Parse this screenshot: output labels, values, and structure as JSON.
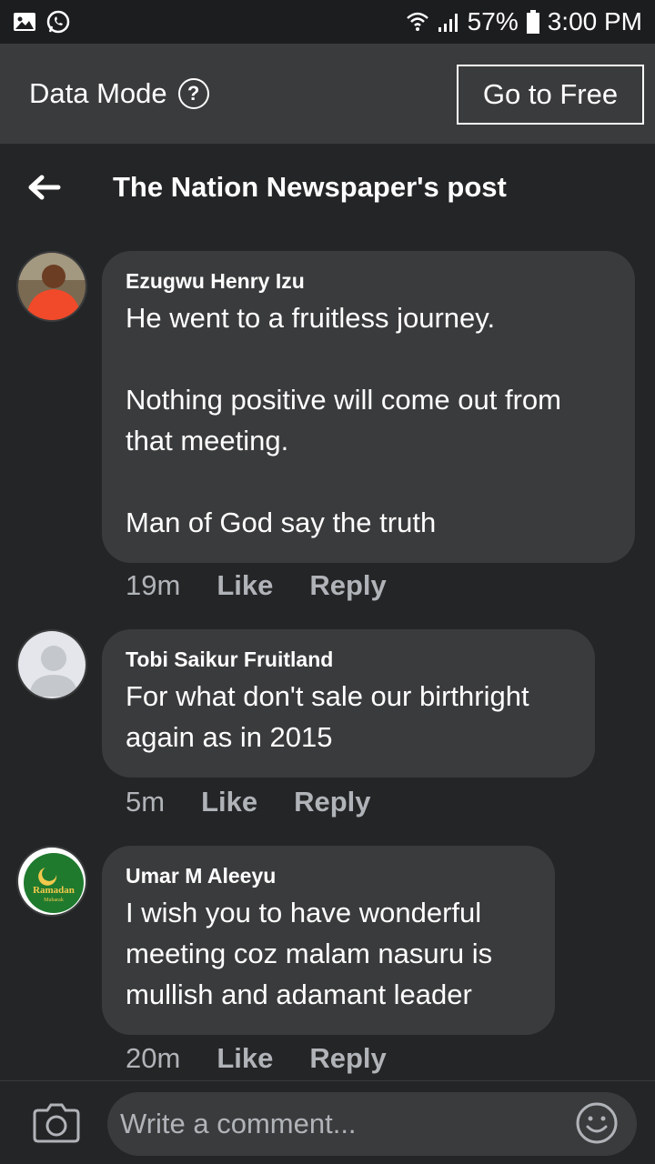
{
  "status_bar": {
    "time": "3:00 PM",
    "battery": "57%"
  },
  "data_bar": {
    "label": "Data Mode",
    "help": "?",
    "go_free_label": "Go to Free"
  },
  "header": {
    "title": "The Nation Newspaper's post"
  },
  "comments": [
    {
      "author": "Ezugwu Henry Izu",
      "text": "He went to a fruitless journey.\n\nNothing positive will come out from that meeting.\n\nMan of God say the truth",
      "time": "19m",
      "like": "Like",
      "reply": "Reply"
    },
    {
      "author": "Tobi Saikur Fruitland",
      "text": "For what don't sale our birthright again as in 2015",
      "time": "5m",
      "like": "Like",
      "reply": "Reply"
    },
    {
      "author": "Umar M Aleeyu",
      "text": "I wish you to have wonderful meeting coz malam nasuru is mullish and adamant leader",
      "time": "20m",
      "like": "Like",
      "reply": "Reply",
      "avatar_text": "Ramadan",
      "avatar_subtext": "Mubarak"
    }
  ],
  "composer": {
    "placeholder": "Write a comment..."
  },
  "colors": {
    "background": "#18191a",
    "surface": "#242526",
    "bubble": "#3a3b3c",
    "secondary_text": "#b0b3b8"
  }
}
